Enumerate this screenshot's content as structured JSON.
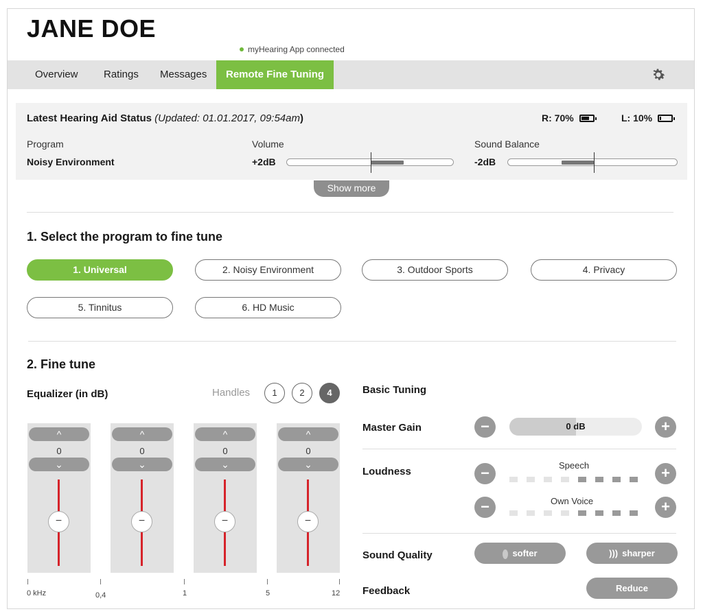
{
  "header": {
    "patient_name": "JANE DOE",
    "connection_status": "myHearing App connected",
    "connection_color": "#6fb93a"
  },
  "nav": {
    "tabs": [
      {
        "label": "Overview",
        "active": false
      },
      {
        "label": "Ratings",
        "active": false
      },
      {
        "label": "Messages",
        "active": false
      },
      {
        "label": "Remote Fine Tuning",
        "active": true
      }
    ],
    "settings_icon": "gear-icon",
    "accent_color": "#7cbf43"
  },
  "status": {
    "title": "Latest Hearing Aid Status",
    "updated": "(Updated: 01.01.2017, 09:54am",
    "updated_close": ")",
    "battery_right": {
      "label": "R: 70%",
      "level": 0.7
    },
    "battery_left": {
      "label": "L: 10%",
      "level": 0.1
    },
    "program_label": "Program",
    "program_value": "Noisy Environment",
    "volume_label": "Volume",
    "volume_value": "+2dB",
    "balance_label": "Sound Balance",
    "balance_value": "-2dB",
    "show_more": "Show more"
  },
  "programs": {
    "title": "1. Select the program to fine tune",
    "items": [
      {
        "label": "1. Universal",
        "active": true
      },
      {
        "label": "2. Noisy Environment",
        "active": false
      },
      {
        "label": "3. Outdoor Sports",
        "active": false
      },
      {
        "label": "4. Privacy",
        "active": false
      },
      {
        "label": "5. Tinnitus",
        "active": false
      },
      {
        "label": "6. HD Music",
        "active": false
      }
    ]
  },
  "fine_tune": {
    "title": "2. Fine tune",
    "equalizer": {
      "title": "Equalizer (in dB)",
      "handles_label": "Handles",
      "handles": [
        {
          "label": "1",
          "active": false
        },
        {
          "label": "2",
          "active": false
        },
        {
          "label": "4",
          "active": true
        }
      ],
      "bands": [
        {
          "value": "0",
          "knob": "−"
        },
        {
          "value": "0",
          "knob": "−"
        },
        {
          "value": "0",
          "knob": "−"
        },
        {
          "value": "0",
          "knob": "−"
        }
      ],
      "up_glyph": "^",
      "down_glyph": "⌄",
      "freq_labels": [
        "0 kHz",
        "0,4",
        "1",
        "5",
        "12"
      ]
    },
    "basic_tuning": {
      "title": "Basic Tuning",
      "master_gain_label": "Master Gain",
      "master_gain_value": "0 dB",
      "master_gain_level": 0.5,
      "loudness_label": "Loudness",
      "speech_label": "Speech",
      "own_voice_label": "Own Voice",
      "speech_level": 4,
      "own_voice_level": 4,
      "level_steps": 8,
      "sound_quality_label": "Sound Quality",
      "softer_label": "softer",
      "sharper_label": "sharper",
      "feedback_label": "Feedback",
      "reduce_label": "Reduce",
      "minus_glyph": "−",
      "plus_glyph": "+"
    }
  }
}
